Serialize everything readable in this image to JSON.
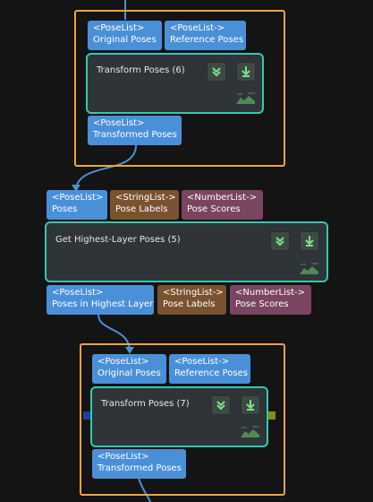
{
  "graph": {
    "group1": {
      "inputs": [
        {
          "type": "<PoseList>",
          "name": "Original Poses"
        },
        {
          "type": "<PoseList->",
          "name": "Reference Poses"
        }
      ],
      "node_title": "Transform Poses (6)",
      "outputs": [
        {
          "type": "<PoseList>",
          "name": "Transformed Poses"
        }
      ]
    },
    "node2": {
      "inputs": [
        {
          "type": "<PoseList>",
          "name": "Poses"
        },
        {
          "type": "<StringList->",
          "name": "Pose Labels"
        },
        {
          "type": "<NumberList->",
          "name": "Pose Scores"
        }
      ],
      "title": "Get Highest-Layer Poses (5)",
      "outputs": [
        {
          "type": "<PoseList>",
          "name": "Poses in Highest Layer"
        },
        {
          "type": "<StringList->",
          "name": "Pose Labels"
        },
        {
          "type": "<NumberList->",
          "name": "Pose Scores"
        }
      ]
    },
    "group2": {
      "inputs": [
        {
          "type": "<PoseList>",
          "name": "Original Poses"
        },
        {
          "type": "<PoseList->",
          "name": "Reference Poses"
        }
      ],
      "node_title": "Transform Poses (7)",
      "outputs": [
        {
          "type": "<PoseList>",
          "name": "Transformed Poses"
        }
      ]
    }
  },
  "colors": {
    "background": "#141414",
    "group_border": "#f0a43a",
    "node_border": "#34c8b0",
    "node_fill": "#2f3438",
    "pose_port": "#4a90d9",
    "string_port": "#7a5230",
    "number_port": "#7a4560",
    "wire": "#4a90d9"
  },
  "icons": [
    "collapse-icon",
    "download-icon",
    "status-graph-icon"
  ]
}
